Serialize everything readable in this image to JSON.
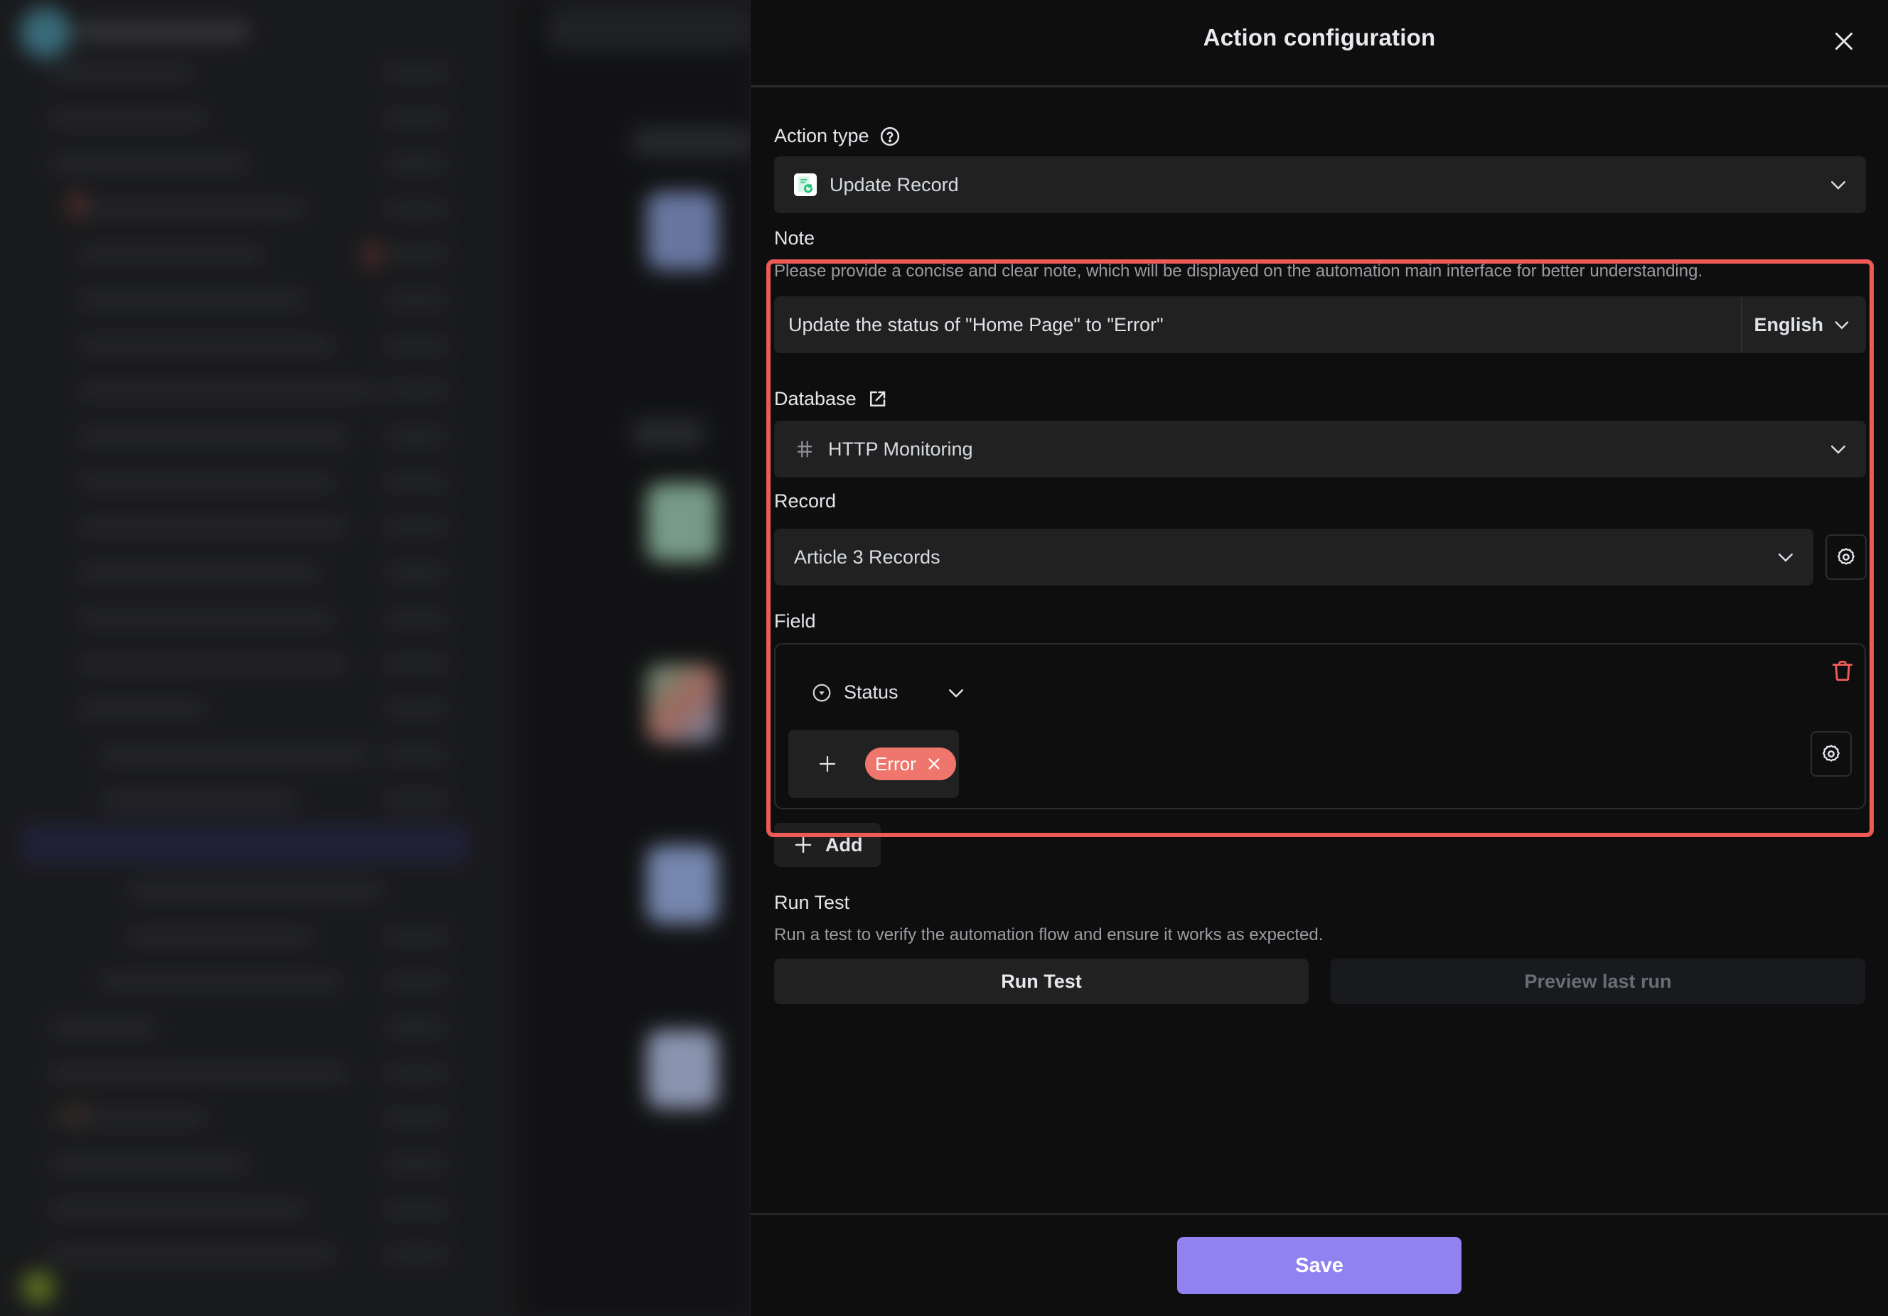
{
  "panel": {
    "title": "Action configuration",
    "close_icon": "close-icon"
  },
  "action_type": {
    "label": "Action type",
    "help_icon": "question-circle-icon",
    "value": "Update Record",
    "icon": "update-record-icon"
  },
  "note": {
    "label": "Note",
    "helper": "Please provide a concise and clear note, which will be displayed on the automation main interface for better understanding.",
    "value": "Update the status of \"Home Page\" to \"Error\"",
    "language": "English"
  },
  "database": {
    "label": "Database",
    "link_icon": "external-link-icon",
    "value": "HTTP Monitoring",
    "icon": "hash-icon"
  },
  "record": {
    "label": "Record",
    "value": "Article 3 Records",
    "settings_icon": "gear-icon"
  },
  "field": {
    "label": "Field",
    "items": [
      {
        "name": "Status",
        "icon": "single-select-icon",
        "values": [
          {
            "label": "Error",
            "color": "#ef766d"
          }
        ]
      }
    ],
    "add_label": "Add"
  },
  "run_test": {
    "label": "Run Test",
    "description": "Run a test to verify the automation flow and ensure it works as expected.",
    "run_button": "Run Test",
    "preview_button": "Preview last run"
  },
  "footer": {
    "save_label": "Save",
    "save_color": "#9182f1"
  },
  "colors": {
    "highlight": "#ee5a55",
    "panel_bg": "#0e0e0f",
    "input_bg": "#212121",
    "error_tag": "#ef766d",
    "accent": "#9182f1"
  }
}
